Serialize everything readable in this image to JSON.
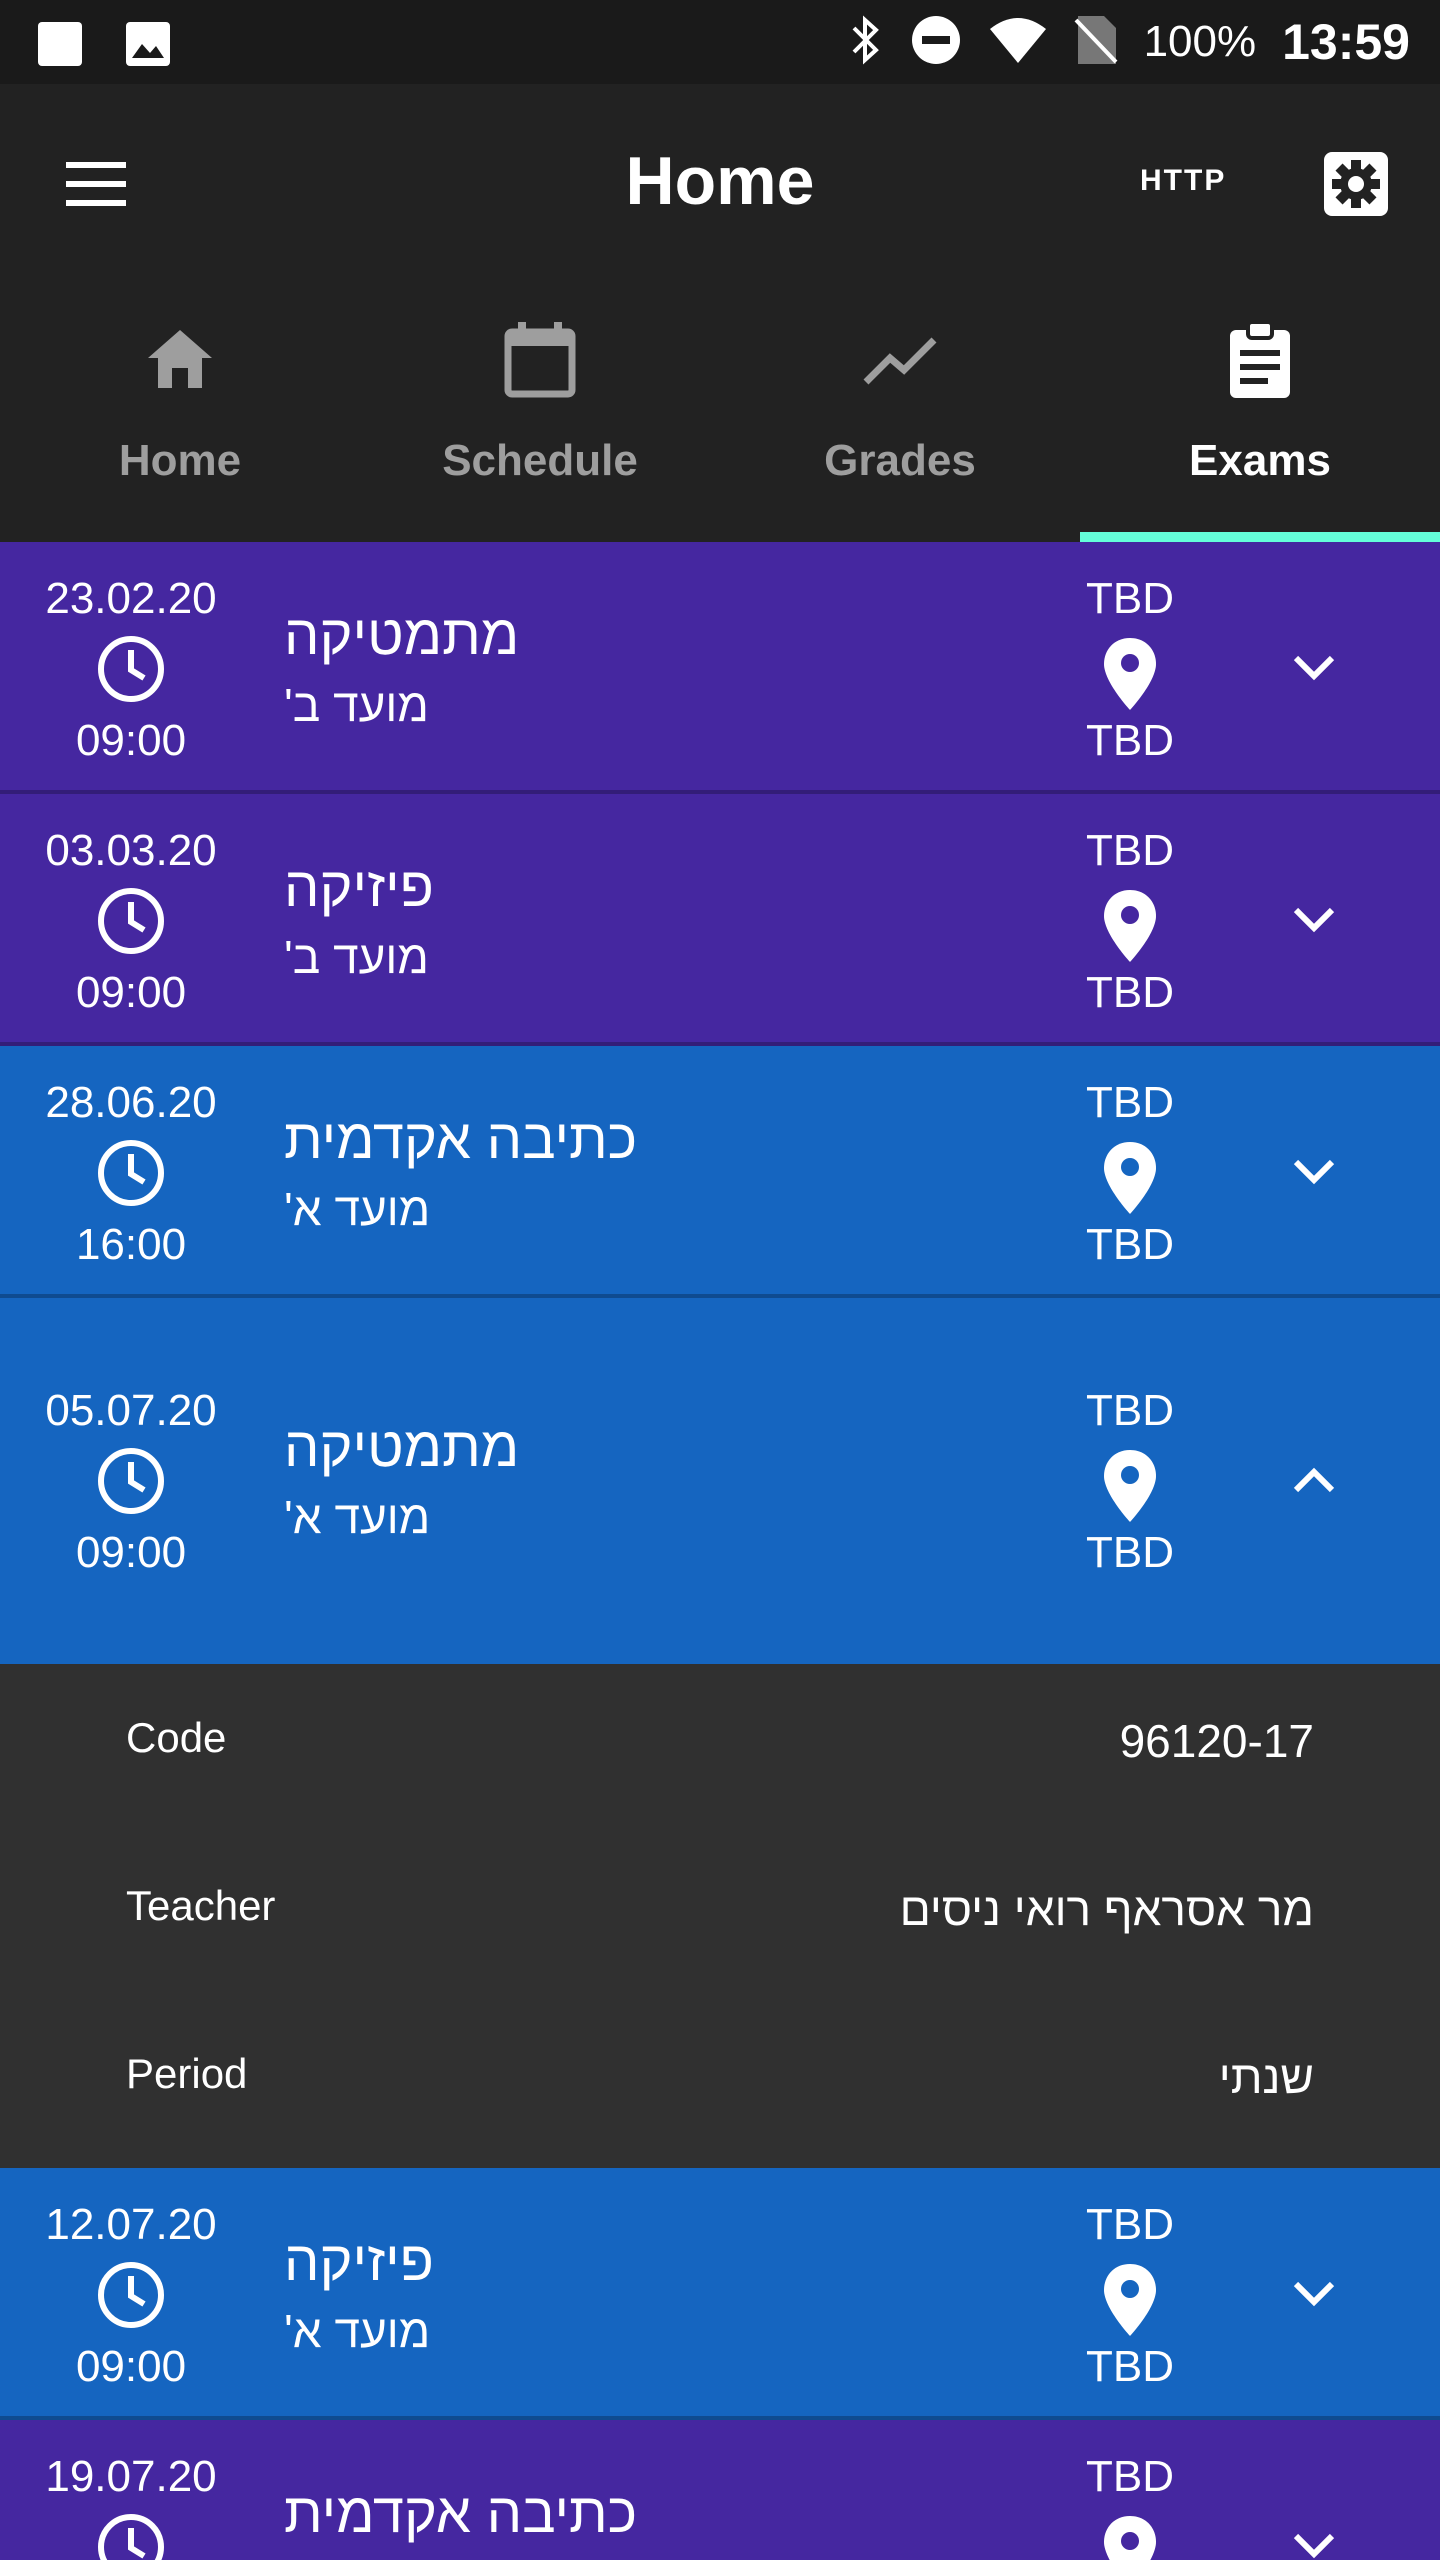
{
  "statusbar": {
    "battery": "100%",
    "time": "13:59"
  },
  "header": {
    "title": "Home",
    "http_label": "HTTP"
  },
  "tabs": [
    {
      "label": "Home",
      "icon": "home-icon"
    },
    {
      "label": "Schedule",
      "icon": "calendar-icon"
    },
    {
      "label": "Grades",
      "icon": "trending-line-icon"
    },
    {
      "label": "Exams",
      "icon": "clipboard-icon",
      "active": true
    }
  ],
  "exams": [
    {
      "date": "23.02.20",
      "time": "09:00",
      "subject": "מתמטיקה",
      "term": "מועד ב'",
      "room": "TBD",
      "building": "TBD",
      "color": "#4527a0"
    },
    {
      "date": "03.03.20",
      "time": "09:00",
      "subject": "פיזיקה",
      "term": "מועד ב'",
      "room": "TBD",
      "building": "TBD",
      "color": "#4527a0"
    },
    {
      "date": "28.06.20",
      "time": "16:00",
      "subject": "כתיבה אקדמית",
      "term": "מועד א'",
      "room": "TBD",
      "building": "TBD",
      "color": "#1565c0"
    },
    {
      "date": "05.07.20",
      "time": "09:00",
      "subject": "מתמטיקה",
      "term": "מועד א'",
      "room": "TBD",
      "building": "TBD",
      "color": "#1565c0",
      "expanded": true
    },
    {
      "date": "12.07.20",
      "time": "09:00",
      "subject": "פיזיקה",
      "term": "מועד א'",
      "room": "TBD",
      "building": "TBD",
      "color": "#1565c0"
    },
    {
      "date": "19.07.20",
      "time": "",
      "subject": "כתיבה אקדמית",
      "term": "",
      "room": "TBD",
      "building": "",
      "color": "#4527a0"
    }
  ],
  "details": [
    {
      "label": "Code",
      "value": "96120-17"
    },
    {
      "label": "Teacher",
      "value": "מר אסראף רואי ניסים"
    },
    {
      "label": "Period",
      "value": "שנתי"
    }
  ]
}
